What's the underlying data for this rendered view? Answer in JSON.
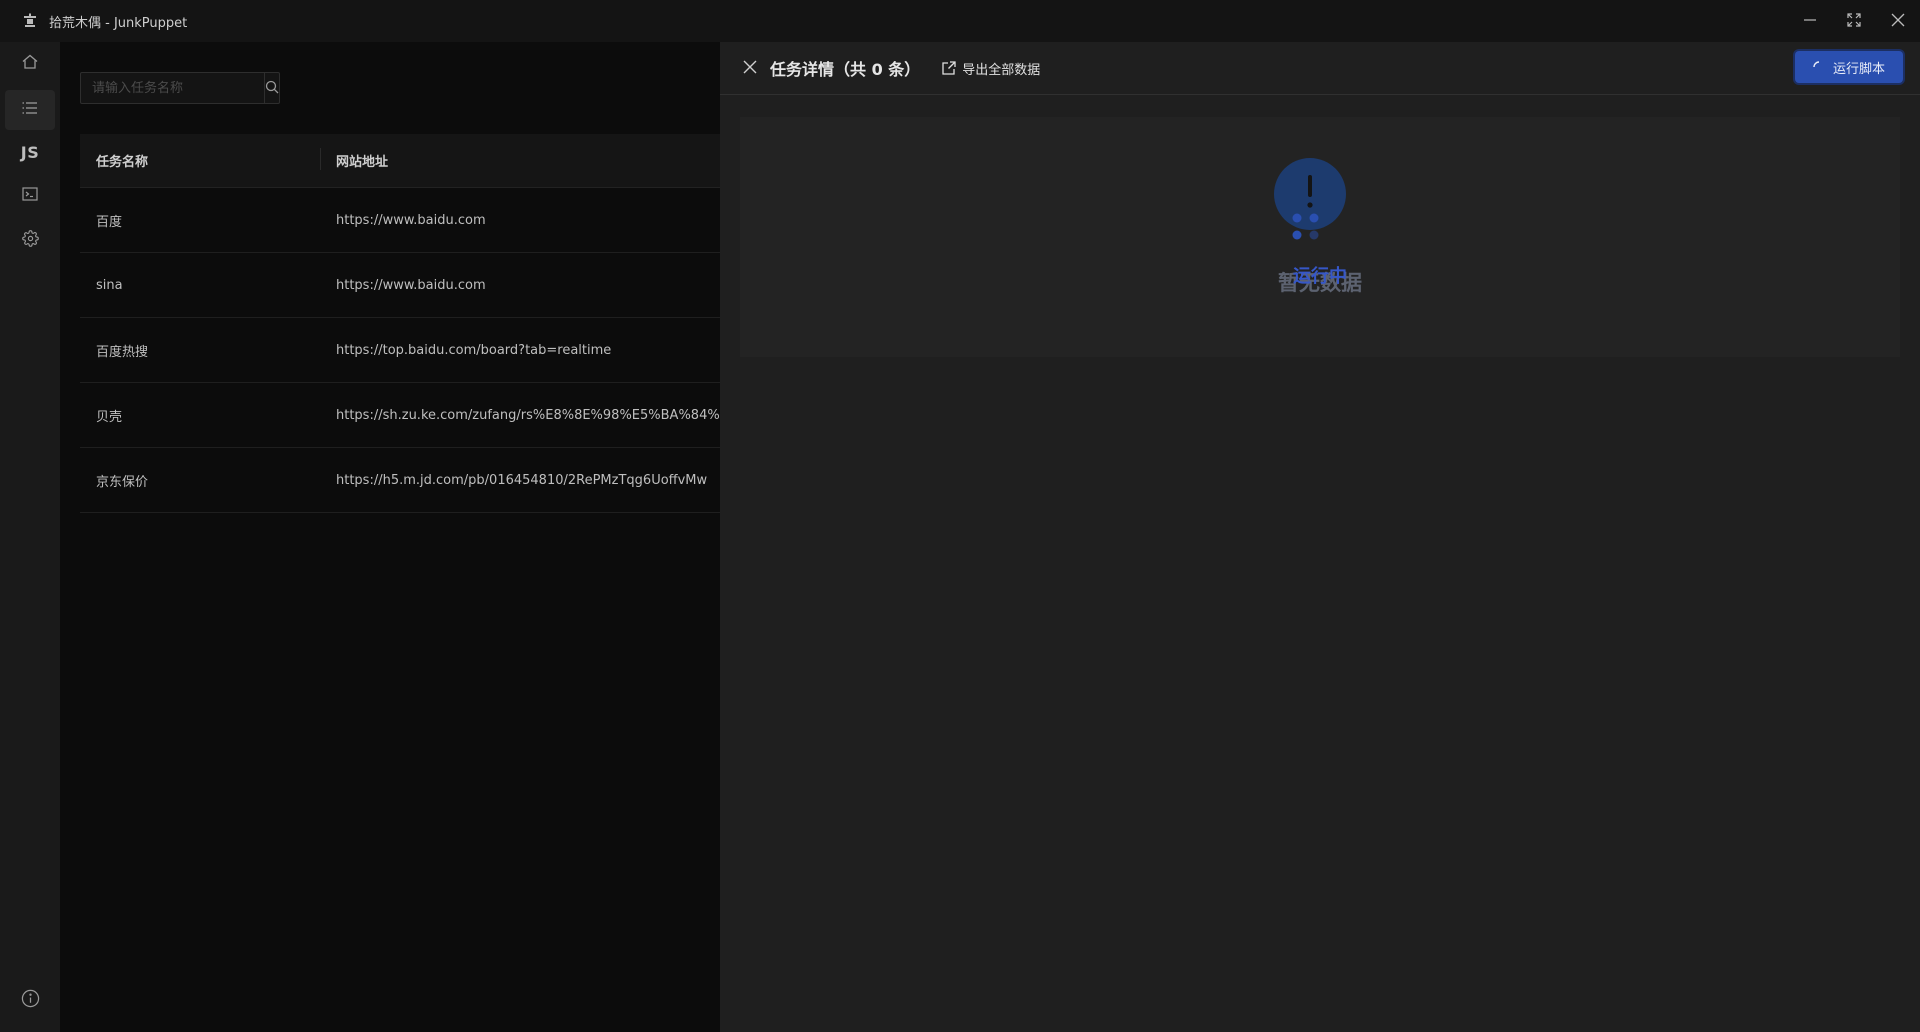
{
  "app": {
    "title": "拾荒木偶 - JunkPuppet",
    "icon": "puppet-icon"
  },
  "window_controls": [
    "minimize-icon",
    "maximize-icon",
    "close-icon"
  ],
  "sidebar": {
    "items": [
      {
        "icon": "home-icon",
        "active": false
      },
      {
        "icon": "list-icon",
        "active": true
      },
      {
        "icon": "js-icon",
        "label": "JS",
        "active": false
      },
      {
        "icon": "terminal-icon",
        "active": false
      },
      {
        "icon": "gear-icon",
        "active": false
      }
    ],
    "bottom_icon": "info-icon"
  },
  "search": {
    "placeholder": "请输入任务名称",
    "value": ""
  },
  "table": {
    "headers": [
      "任务名称",
      "网站地址"
    ],
    "rows": [
      {
        "name": "百度",
        "url": "https://www.baidu.com"
      },
      {
        "name": "sina",
        "url": "https://www.baidu.com"
      },
      {
        "name": "百度热搜",
        "url": "https://top.baidu.com/board?tab=realtime"
      },
      {
        "name": "贝壳",
        "url": "https://sh.zu.ke.com/zufang/rs%E8%8E%98%E5%BA%84%"
      },
      {
        "name": "京东保价",
        "url": "https://h5.m.jd.com/pb/016454810/2RePMzTqg6UoffvMw"
      }
    ]
  },
  "drawer": {
    "title": "任务详情（共 0 条）",
    "export_label": "导出全部数据",
    "run_label": "运行脚本",
    "empty_text": "暂无数据",
    "loading_text": "运行中"
  },
  "colors": {
    "accent": "#2a4fb0",
    "loading": "#3657c8",
    "background": "#141414",
    "drawer": "#1f1f1f"
  }
}
